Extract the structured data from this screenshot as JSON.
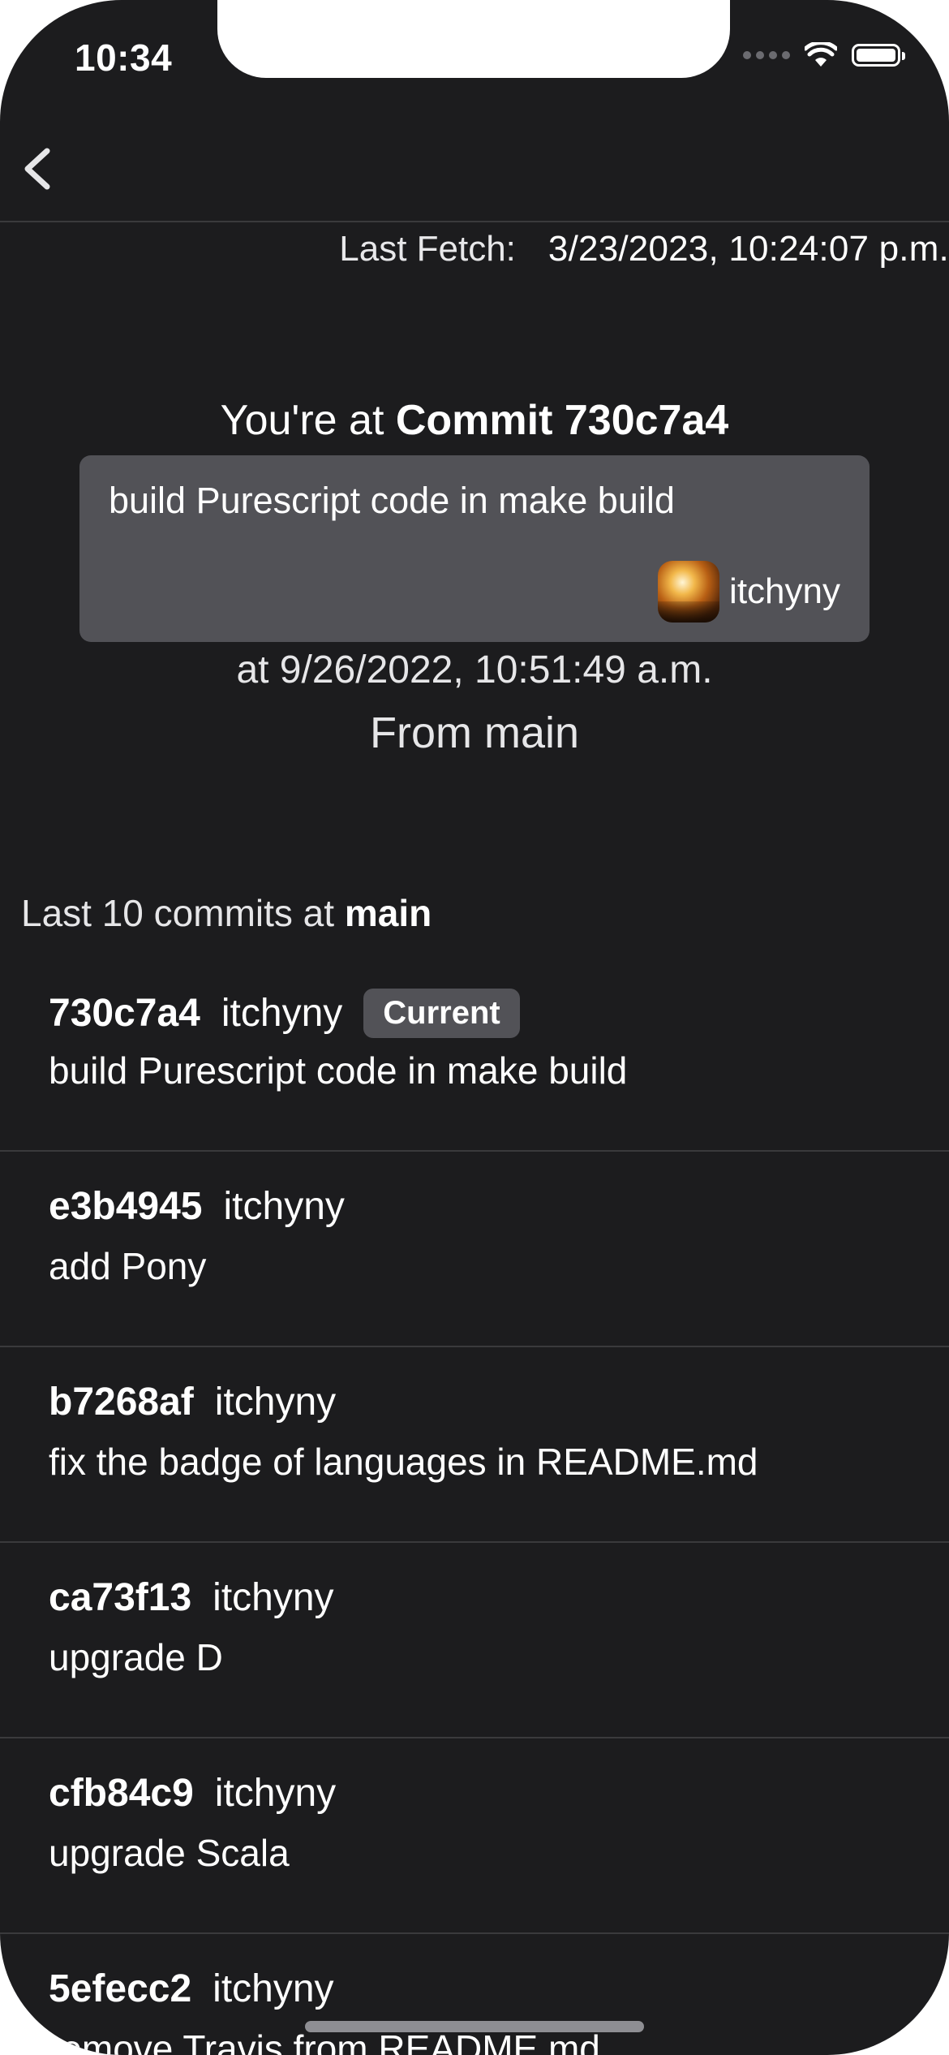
{
  "status_bar": {
    "time": "10:34"
  },
  "nav": {
    "back_icon": "chevron-left-icon"
  },
  "last_fetch": {
    "label": "Last Fetch:",
    "value": "3/23/2023, 10:24:07 p.m."
  },
  "current_commit": {
    "prefix": "You're at",
    "title": "Commit 730c7a4",
    "message": "build Purescript code in make build",
    "author": "itchyny",
    "date_line": "at 9/26/2022, 10:51:49 a.m.",
    "branch_line": "From main"
  },
  "commits_section": {
    "prefix": "Last 10 commits at",
    "branch": "main",
    "current_badge": "Current",
    "items": [
      {
        "sha": "730c7a4",
        "author": "itchyny",
        "message": "build Purescript code in make build",
        "is_current": true
      },
      {
        "sha": "e3b4945",
        "author": "itchyny",
        "message": "add Pony",
        "is_current": false
      },
      {
        "sha": "b7268af",
        "author": "itchyny",
        "message": "fix the badge of languages in README.md",
        "is_current": false
      },
      {
        "sha": "ca73f13",
        "author": "itchyny",
        "message": "upgrade D",
        "is_current": false
      },
      {
        "sha": "cfb84c9",
        "author": "itchyny",
        "message": "upgrade Scala",
        "is_current": false
      },
      {
        "sha": "5efecc2",
        "author": "itchyny",
        "message": "remove Travis from README.md",
        "is_current": false
      }
    ]
  },
  "colors": {
    "background": "#1c1c1e",
    "card": "#525257",
    "divider": "#3a3a3c",
    "text": "#ffffff"
  }
}
